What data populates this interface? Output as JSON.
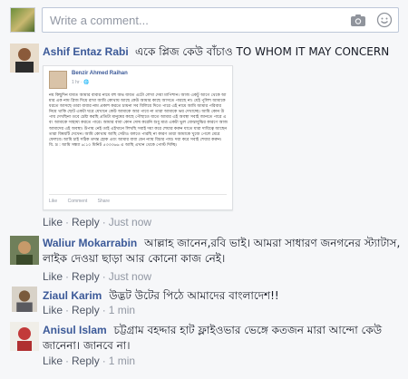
{
  "composer": {
    "placeholder": "Write a comment...",
    "camera_icon": "camera-icon",
    "emoji_icon": "smiley-icon"
  },
  "comments": [
    {
      "author": "Ashif Entaz Rabi",
      "text": "একে প্লিজ কেউ বাঁচাও TO WHOM IT MAY CONCERN",
      "embed": {
        "name": "Benzir Ahmed Raihan",
        "meta": "1 hr · 🌐",
        "text": "নয় কিছুদিন যাবত আমার বাবার নামে বহু অভ যাবত এটো লেখা দেয়া মাপিশান। আজ একটু আগে থেকে আমার এক নাম প্লিজ দিয়ে রাখা আমি কোথায় আছে কেউ আমার কাছে আসতে পারছে না। যেই পুলিশ আমাকে ধরতে আসছে তারা বাবার নাম প্রকাশ করতে চায়না সব বিলিয়ে দিতে পারে এই নামে আমি আমার পরিবার নিয়ে থাকি ছোট একটা ঘরে যেখানে কেউ আমাকে আর পাবে না তারা আমাকে ভয় দেখাচ্ছে। আমি কোন উপায় দেখছিনা তবে চেষ্টা করছি প্রতিটা মানুষের কাছে পৌছাতে যাতে আমার এই অবস্থা সবাই জানতে পারে এবং আমাকে সাহায্য করতে পারে। আমার বাবা কোন দোষ করেনি শুধু মাত্র একটা ভুল বোঝাবুঝির কারণে আজ আমাদের এই অবস্থা। উপায় নেই তাই এইখানে লিখছি সবাই দয়া করে শেয়ার করুন যাতে যারা দায়িত্বে আছেন তারা বিষয়টি দেখেন। আমি কোথায় আছি সেটাও বলতে পারছি না কারণ তারা আমাকে খুজে পেলে মেরে ফেলবে। আমি চাই সঠিক তদন্ত হোক এবং আমার বাবা যেন ন্যায় বিচার পায়। দয়া করে সবাই শেয়ার করুন।",
        "footnote": "বি. দ্র : আমি সন্ধ্যা ৬:১০ মিনিট ৫৩৩৩৬৬ এ আছি এখান থেকে পোস্ট দিচ্ছি।",
        "like": "Like",
        "comment": "Comment",
        "share": "Share"
      },
      "like": "Like",
      "reply": "Reply",
      "time": "Just now"
    },
    {
      "author": "Waliur Mokarrabin",
      "text": "আল্লাহ জানেন,রবি ভাই। আমরা সাধারণ জনগনের স্ট্যাটাস, লাইক দেওয়া ছাড়া আর কোনো কাজ নেই।",
      "like": "Like",
      "reply": "Reply",
      "time": "Just now"
    },
    {
      "author": "Ziaul Karim",
      "text": "উদ্ভট উটের পিঠে আমাদের বাংলাদেশ!!",
      "like": "Like",
      "reply": "Reply",
      "time": "1 min"
    },
    {
      "author": "Anisul Islam",
      "text": "চট্টগ্রাম বহদ্দার হাট ফ্লাইওভার ভেঙ্গে কতজন মারা আন্দো কেউ জানেনা। জানবে না।",
      "like": "Like",
      "reply": "Reply",
      "time": "1 min"
    }
  ]
}
